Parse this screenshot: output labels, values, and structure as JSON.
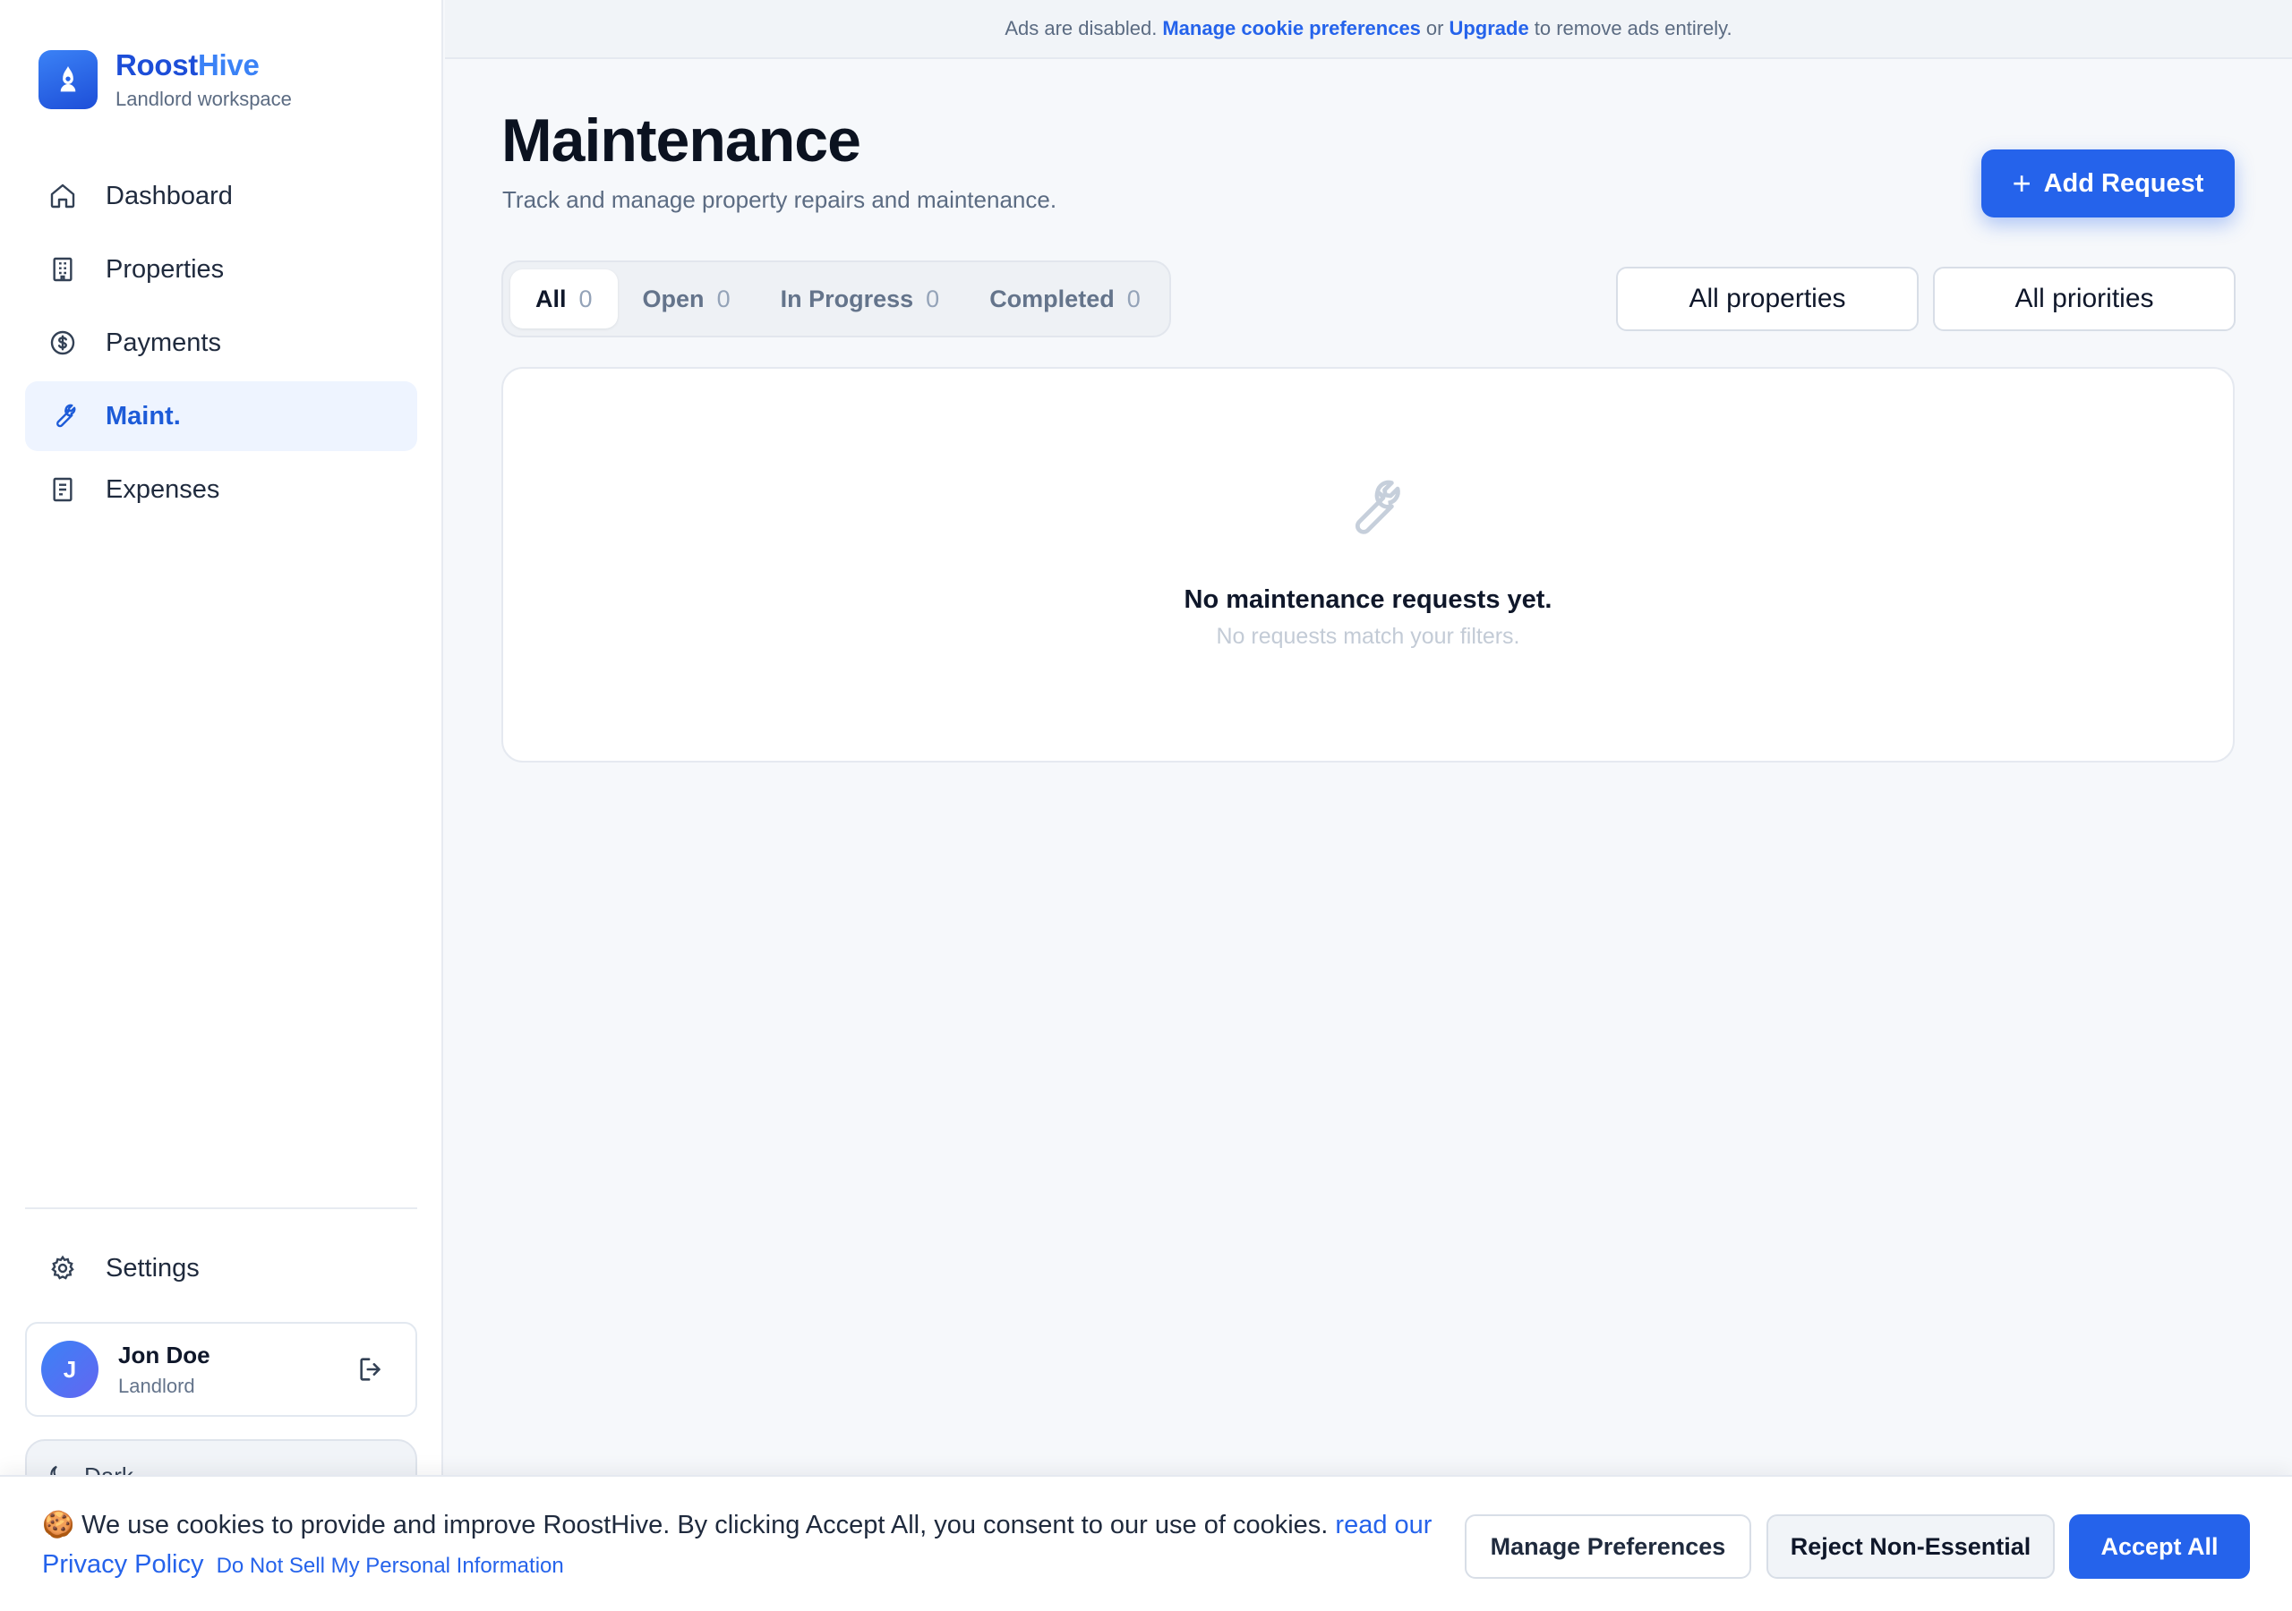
{
  "brand": {
    "name_part1": "Roost",
    "name_part2": "Hive",
    "subtitle": "Landlord workspace"
  },
  "nav": {
    "items": [
      {
        "label": "Dashboard",
        "icon": "home-icon"
      },
      {
        "label": "Properties",
        "icon": "building-icon"
      },
      {
        "label": "Payments",
        "icon": "dollar-circle-icon"
      },
      {
        "label": "Maint.",
        "icon": "wrench-icon",
        "active": true
      },
      {
        "label": "Expenses",
        "icon": "receipt-icon"
      }
    ],
    "settings_label": "Settings"
  },
  "user": {
    "initial": "J",
    "name": "Jon Doe",
    "role": "Landlord"
  },
  "theme": {
    "label": "Dark"
  },
  "adbar": {
    "text_before": "Ads are disabled.",
    "manage_link": "Manage cookie preferences",
    "or_text": "or",
    "upgrade_link": "Upgrade",
    "text_after": "to remove ads entirely."
  },
  "page": {
    "title": "Maintenance",
    "subtitle": "Track and manage property repairs and maintenance.",
    "add_button": "Add Request"
  },
  "tabs": [
    {
      "label": "All",
      "count": "0",
      "active": true
    },
    {
      "label": "Open",
      "count": "0"
    },
    {
      "label": "In Progress",
      "count": "0"
    },
    {
      "label": "Completed",
      "count": "0"
    }
  ],
  "filters": {
    "properties": "All properties",
    "priorities": "All priorities"
  },
  "empty_state": {
    "title": "No maintenance requests yet.",
    "subtitle": "No requests match your filters."
  },
  "cookie": {
    "text": "🍪 We use cookies to provide and improve RoostHive. By clicking Accept All, you consent to our use of cookies.",
    "policy_link": "read our Privacy Policy",
    "dns_link": "Do Not Sell My Personal Information",
    "manage_button": "Manage Preferences",
    "reject_button": "Reject Non-Essential",
    "accept_button": "Accept All"
  },
  "colors": {
    "accent": "#2563eb",
    "accent_light": "#3b82f6",
    "active_nav_bg": "#eef4ff"
  }
}
